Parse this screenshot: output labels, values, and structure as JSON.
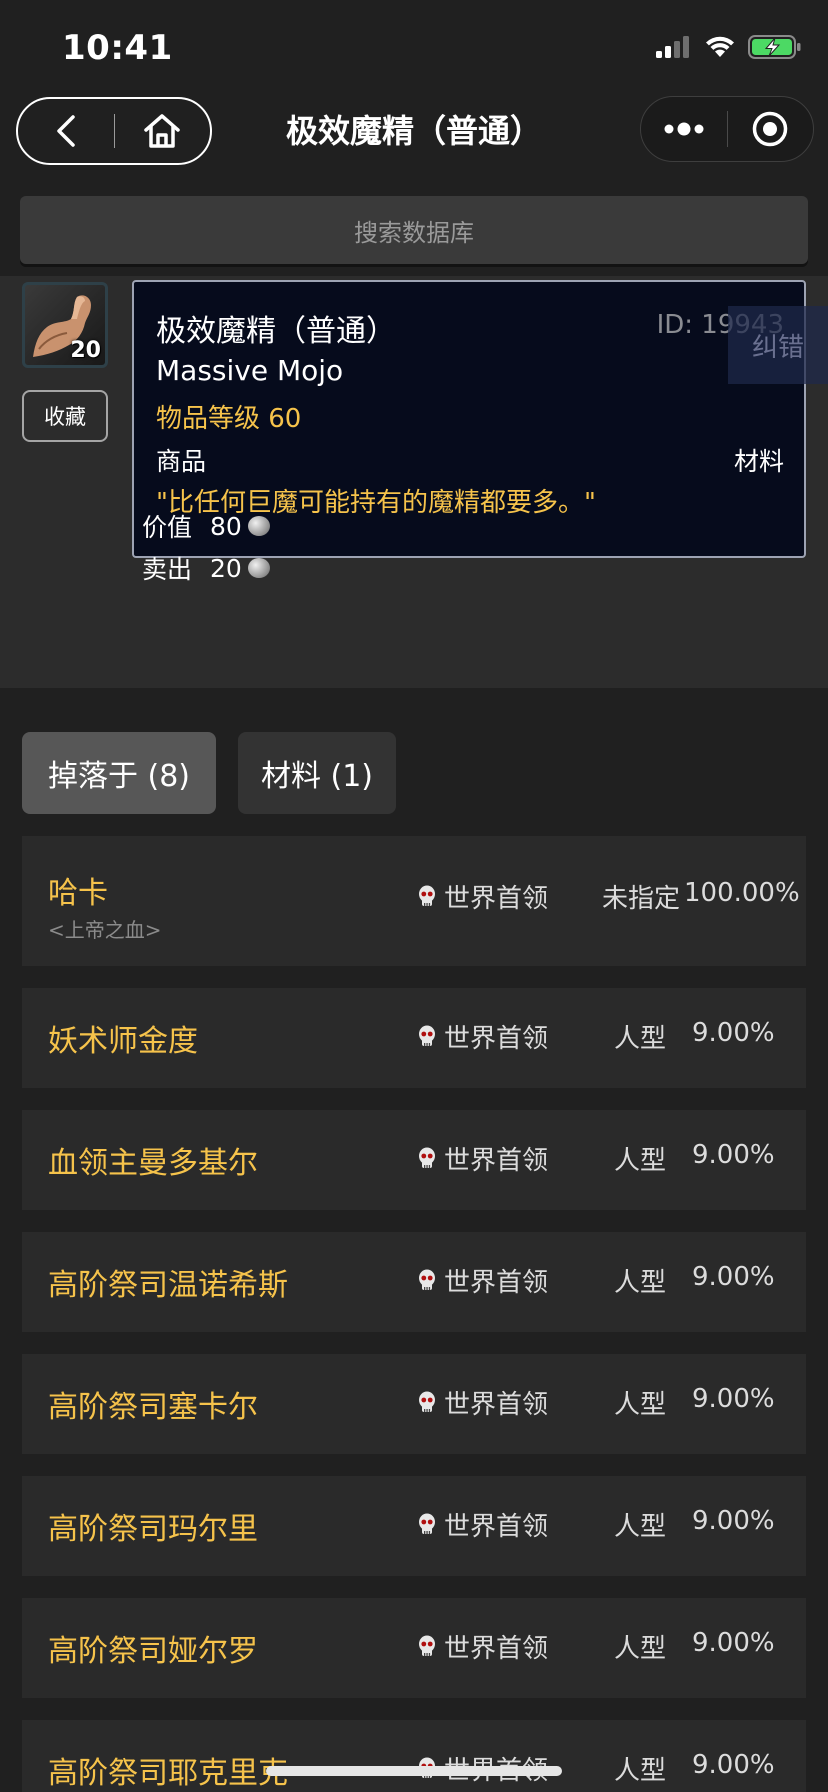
{
  "status_bar": {
    "time": "10:41"
  },
  "nav": {
    "title": "极效魔精（普通）"
  },
  "search": {
    "placeholder": "搜索数据库"
  },
  "item": {
    "icon": "muscle-arm-icon",
    "stack_count": "20",
    "favorite_label": "收藏",
    "name": "极效魔精（普通）",
    "id_text": "ID: 19943",
    "english_name": "Massive Mojo",
    "item_level": "物品等级 60",
    "class": "商品",
    "subclass": "材料",
    "description": "\"比任何巨魔可能持有的魔精都要多。\"",
    "report_label": "纠错",
    "price": {
      "value_label": "价值",
      "value_amount": "80",
      "sell_label": "卖出",
      "sell_amount": "20"
    }
  },
  "tabs": [
    {
      "label": "掉落于 (8)",
      "active": true
    },
    {
      "label": "材料 (1)",
      "active": false
    }
  ],
  "drops": [
    {
      "name": "哈卡",
      "subtitle": "<上帝之血>",
      "type": "世界首领",
      "category": "未指定",
      "rate": "100.00%"
    },
    {
      "name": "妖术师金度",
      "subtitle": "",
      "type": "世界首领",
      "category": "人型",
      "rate": "9.00%"
    },
    {
      "name": "血领主曼多基尔",
      "subtitle": "",
      "type": "世界首领",
      "category": "人型",
      "rate": "9.00%"
    },
    {
      "name": "高阶祭司温诺希斯",
      "subtitle": "",
      "type": "世界首领",
      "category": "人型",
      "rate": "9.00%"
    },
    {
      "name": "高阶祭司塞卡尔",
      "subtitle": "",
      "type": "世界首领",
      "category": "人型",
      "rate": "9.00%"
    },
    {
      "name": "高阶祭司玛尔里",
      "subtitle": "",
      "type": "世界首领",
      "category": "人型",
      "rate": "9.00%"
    },
    {
      "name": "高阶祭司娅尔罗",
      "subtitle": "",
      "type": "世界首领",
      "category": "人型",
      "rate": "9.00%"
    },
    {
      "name": "高阶祭司耶克里克",
      "subtitle": "",
      "type": "世界首领",
      "category": "人型",
      "rate": "9.00%"
    }
  ],
  "colors": {
    "background": "#202020",
    "accent_gold": "#f6c34b",
    "tooltip_bg": "#060b1c",
    "battery_green": "#4cd964"
  }
}
